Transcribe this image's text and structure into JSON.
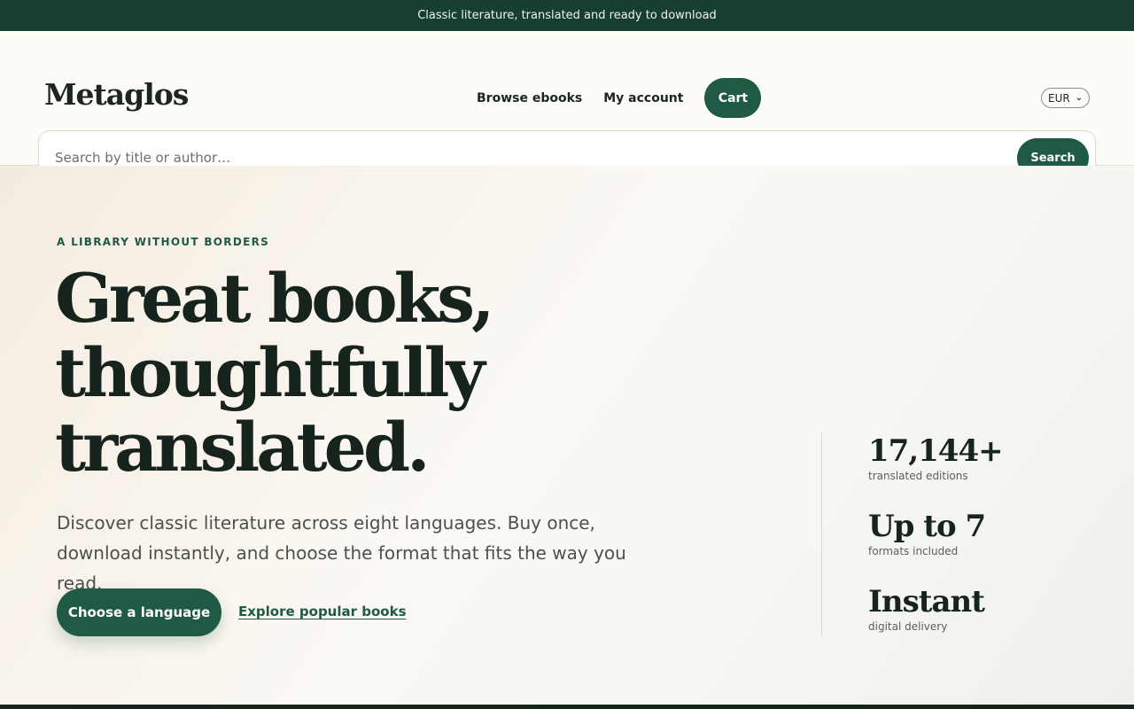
{
  "announcement": "Classic literature, translated and ready to download",
  "header": {
    "logo": "Metaglos",
    "nav": {
      "browse_label": "Browse ebooks",
      "account_label": "My account",
      "cart_label": "Cart"
    },
    "currency": "EUR"
  },
  "search": {
    "placeholder": "Search by title or author…",
    "button_label": "Search"
  },
  "hero": {
    "eyebrow": "A LIBRARY WITHOUT BORDERS",
    "headline": [
      "Great books,",
      "thoughtfully",
      "translated."
    ],
    "lede": "Discover classic literature across eight languages. Buy once, download instantly, and choose the format that fits the way you read.",
    "primary_cta": "Choose a language",
    "secondary_cta": "Explore popular books"
  },
  "stats": [
    {
      "value": "17,144+",
      "label": "translated editions"
    },
    {
      "value": "Up to 7",
      "label": "formats included"
    },
    {
      "value": "Instant",
      "label": "digital delivery"
    }
  ],
  "colors": {
    "accent": "#1f5a44",
    "announcement_bg": "#173f31",
    "ink": "#17231d"
  },
  "icons": {
    "currency_dropdown": "chevron-down-icon"
  }
}
